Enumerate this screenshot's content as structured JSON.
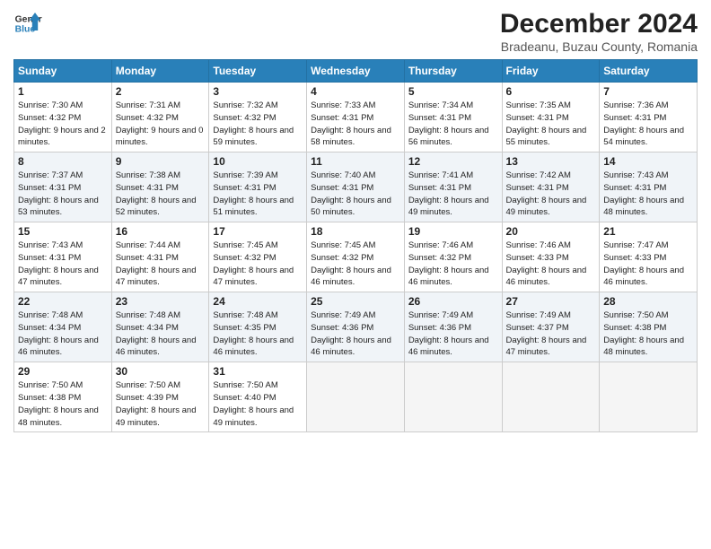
{
  "logo": {
    "line1": "General",
    "line2": "Blue"
  },
  "title": "December 2024",
  "subtitle": "Bradeanu, Buzau County, Romania",
  "weekdays": [
    "Sunday",
    "Monday",
    "Tuesday",
    "Wednesday",
    "Thursday",
    "Friday",
    "Saturday"
  ],
  "weeks": [
    [
      {
        "day": 1,
        "sunrise": "Sunrise: 7:30 AM",
        "sunset": "Sunset: 4:32 PM",
        "daylight": "Daylight: 9 hours and 2 minutes."
      },
      {
        "day": 2,
        "sunrise": "Sunrise: 7:31 AM",
        "sunset": "Sunset: 4:32 PM",
        "daylight": "Daylight: 9 hours and 0 minutes."
      },
      {
        "day": 3,
        "sunrise": "Sunrise: 7:32 AM",
        "sunset": "Sunset: 4:32 PM",
        "daylight": "Daylight: 8 hours and 59 minutes."
      },
      {
        "day": 4,
        "sunrise": "Sunrise: 7:33 AM",
        "sunset": "Sunset: 4:31 PM",
        "daylight": "Daylight: 8 hours and 58 minutes."
      },
      {
        "day": 5,
        "sunrise": "Sunrise: 7:34 AM",
        "sunset": "Sunset: 4:31 PM",
        "daylight": "Daylight: 8 hours and 56 minutes."
      },
      {
        "day": 6,
        "sunrise": "Sunrise: 7:35 AM",
        "sunset": "Sunset: 4:31 PM",
        "daylight": "Daylight: 8 hours and 55 minutes."
      },
      {
        "day": 7,
        "sunrise": "Sunrise: 7:36 AM",
        "sunset": "Sunset: 4:31 PM",
        "daylight": "Daylight: 8 hours and 54 minutes."
      }
    ],
    [
      {
        "day": 8,
        "sunrise": "Sunrise: 7:37 AM",
        "sunset": "Sunset: 4:31 PM",
        "daylight": "Daylight: 8 hours and 53 minutes."
      },
      {
        "day": 9,
        "sunrise": "Sunrise: 7:38 AM",
        "sunset": "Sunset: 4:31 PM",
        "daylight": "Daylight: 8 hours and 52 minutes."
      },
      {
        "day": 10,
        "sunrise": "Sunrise: 7:39 AM",
        "sunset": "Sunset: 4:31 PM",
        "daylight": "Daylight: 8 hours and 51 minutes."
      },
      {
        "day": 11,
        "sunrise": "Sunrise: 7:40 AM",
        "sunset": "Sunset: 4:31 PM",
        "daylight": "Daylight: 8 hours and 50 minutes."
      },
      {
        "day": 12,
        "sunrise": "Sunrise: 7:41 AM",
        "sunset": "Sunset: 4:31 PM",
        "daylight": "Daylight: 8 hours and 49 minutes."
      },
      {
        "day": 13,
        "sunrise": "Sunrise: 7:42 AM",
        "sunset": "Sunset: 4:31 PM",
        "daylight": "Daylight: 8 hours and 49 minutes."
      },
      {
        "day": 14,
        "sunrise": "Sunrise: 7:43 AM",
        "sunset": "Sunset: 4:31 PM",
        "daylight": "Daylight: 8 hours and 48 minutes."
      }
    ],
    [
      {
        "day": 15,
        "sunrise": "Sunrise: 7:43 AM",
        "sunset": "Sunset: 4:31 PM",
        "daylight": "Daylight: 8 hours and 47 minutes."
      },
      {
        "day": 16,
        "sunrise": "Sunrise: 7:44 AM",
        "sunset": "Sunset: 4:31 PM",
        "daylight": "Daylight: 8 hours and 47 minutes."
      },
      {
        "day": 17,
        "sunrise": "Sunrise: 7:45 AM",
        "sunset": "Sunset: 4:32 PM",
        "daylight": "Daylight: 8 hours and 47 minutes."
      },
      {
        "day": 18,
        "sunrise": "Sunrise: 7:45 AM",
        "sunset": "Sunset: 4:32 PM",
        "daylight": "Daylight: 8 hours and 46 minutes."
      },
      {
        "day": 19,
        "sunrise": "Sunrise: 7:46 AM",
        "sunset": "Sunset: 4:32 PM",
        "daylight": "Daylight: 8 hours and 46 minutes."
      },
      {
        "day": 20,
        "sunrise": "Sunrise: 7:46 AM",
        "sunset": "Sunset: 4:33 PM",
        "daylight": "Daylight: 8 hours and 46 minutes."
      },
      {
        "day": 21,
        "sunrise": "Sunrise: 7:47 AM",
        "sunset": "Sunset: 4:33 PM",
        "daylight": "Daylight: 8 hours and 46 minutes."
      }
    ],
    [
      {
        "day": 22,
        "sunrise": "Sunrise: 7:48 AM",
        "sunset": "Sunset: 4:34 PM",
        "daylight": "Daylight: 8 hours and 46 minutes."
      },
      {
        "day": 23,
        "sunrise": "Sunrise: 7:48 AM",
        "sunset": "Sunset: 4:34 PM",
        "daylight": "Daylight: 8 hours and 46 minutes."
      },
      {
        "day": 24,
        "sunrise": "Sunrise: 7:48 AM",
        "sunset": "Sunset: 4:35 PM",
        "daylight": "Daylight: 8 hours and 46 minutes."
      },
      {
        "day": 25,
        "sunrise": "Sunrise: 7:49 AM",
        "sunset": "Sunset: 4:36 PM",
        "daylight": "Daylight: 8 hours and 46 minutes."
      },
      {
        "day": 26,
        "sunrise": "Sunrise: 7:49 AM",
        "sunset": "Sunset: 4:36 PM",
        "daylight": "Daylight: 8 hours and 46 minutes."
      },
      {
        "day": 27,
        "sunrise": "Sunrise: 7:49 AM",
        "sunset": "Sunset: 4:37 PM",
        "daylight": "Daylight: 8 hours and 47 minutes."
      },
      {
        "day": 28,
        "sunrise": "Sunrise: 7:50 AM",
        "sunset": "Sunset: 4:38 PM",
        "daylight": "Daylight: 8 hours and 48 minutes."
      }
    ],
    [
      {
        "day": 29,
        "sunrise": "Sunrise: 7:50 AM",
        "sunset": "Sunset: 4:38 PM",
        "daylight": "Daylight: 8 hours and 48 minutes."
      },
      {
        "day": 30,
        "sunrise": "Sunrise: 7:50 AM",
        "sunset": "Sunset: 4:39 PM",
        "daylight": "Daylight: 8 hours and 49 minutes."
      },
      {
        "day": 31,
        "sunrise": "Sunrise: 7:50 AM",
        "sunset": "Sunset: 4:40 PM",
        "daylight": "Daylight: 8 hours and 49 minutes."
      },
      null,
      null,
      null,
      null
    ]
  ]
}
